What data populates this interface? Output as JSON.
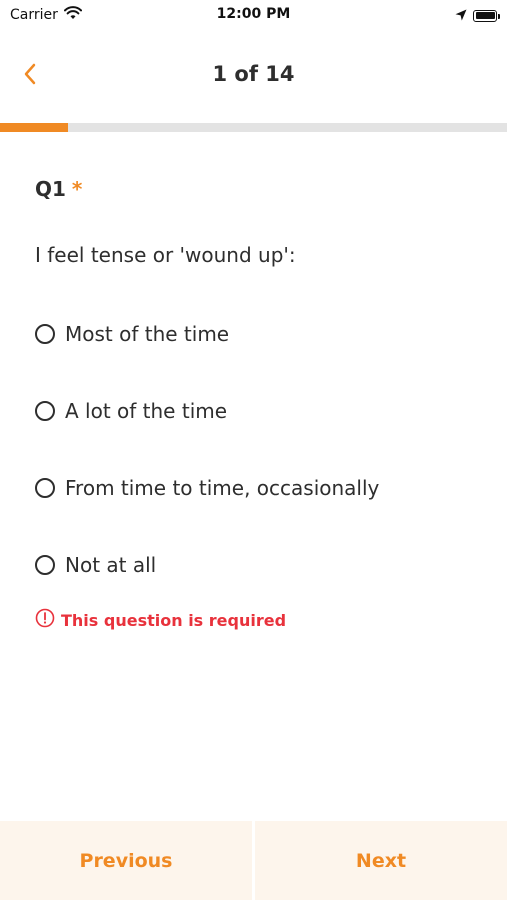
{
  "status_bar": {
    "carrier": "Carrier",
    "time": "12:00 PM",
    "icons": [
      "wifi-icon",
      "location-arrow-icon",
      "battery-icon"
    ]
  },
  "nav": {
    "back_icon": "chevron-left-icon",
    "title": "1 of 14"
  },
  "progress": {
    "fraction": 0.134,
    "color": "#f08a24",
    "track_color": "#e3e3e3"
  },
  "question": {
    "id": "Q1",
    "required_marker": "*",
    "text": "I feel tense or 'wound up':",
    "options": [
      {
        "label": "Most of the time",
        "selected": false
      },
      {
        "label": "A lot of the time",
        "selected": false
      },
      {
        "label": "From time to time, occasionally",
        "selected": false
      },
      {
        "label": "Not at all",
        "selected": false
      }
    ],
    "error_icon": "alert-circle-icon",
    "error": "This question is required"
  },
  "footer": {
    "previous_label": "Previous",
    "next_label": "Next"
  },
  "colors": {
    "accent": "#f08a24",
    "error": "#e8323c",
    "footer_bg": "#fdf5ec"
  }
}
